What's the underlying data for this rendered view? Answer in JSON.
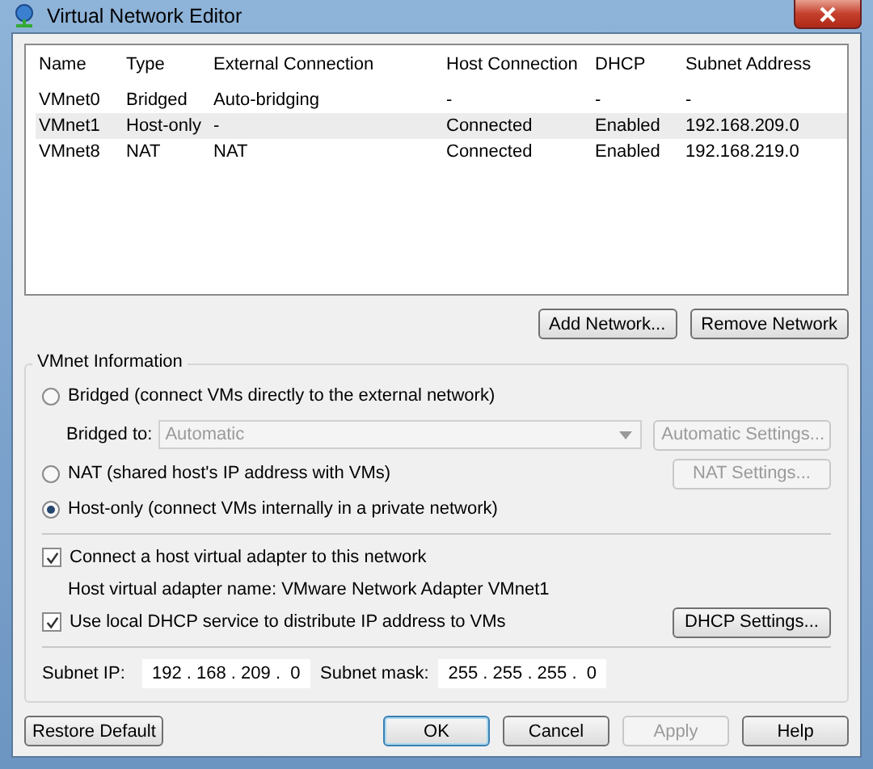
{
  "window": {
    "title": "Virtual Network Editor"
  },
  "table": {
    "columns": [
      "Name",
      "Type",
      "External Connection",
      "Host Connection",
      "DHCP",
      "Subnet Address"
    ],
    "rows": [
      {
        "cells": [
          "VMnet0",
          "Bridged",
          "Auto-bridging",
          "-",
          "-",
          "-"
        ],
        "selected": false
      },
      {
        "cells": [
          "VMnet1",
          "Host-only",
          "-",
          "Connected",
          "Enabled",
          "192.168.209.0"
        ],
        "selected": true
      },
      {
        "cells": [
          "VMnet8",
          "NAT",
          "NAT",
          "Connected",
          "Enabled",
          "192.168.219.0"
        ],
        "selected": false
      }
    ]
  },
  "network_buttons": [
    {
      "label": "Add Network..."
    },
    {
      "label": "Remove Network"
    }
  ],
  "vmnet_info": {
    "title": "VMnet Information",
    "modes": [
      {
        "label": "Bridged (connect VMs directly to the external network)",
        "selected": false
      },
      {
        "label": "NAT (shared host's IP address with VMs)",
        "selected": false
      },
      {
        "label": "Host-only (connect VMs internally in a private network)",
        "selected": true
      }
    ],
    "bridged_to": {
      "label": "Bridged to:",
      "value": "Automatic",
      "disabled": true
    },
    "automatic_settings": {
      "label": "Automatic Settings...",
      "disabled": true
    },
    "nat_settings": {
      "label": "NAT Settings...",
      "disabled": true
    },
    "connect_adapter": {
      "label": "Connect a host virtual adapter to this network",
      "checked": true
    },
    "adapter_name": "Host virtual adapter name: VMware Network Adapter VMnet1",
    "use_dhcp": {
      "label": "Use local DHCP service to distribute IP address to VMs",
      "checked": true
    },
    "dhcp_settings": {
      "label": "DHCP Settings...",
      "disabled": false
    },
    "subnet_ip": {
      "label": "Subnet IP:",
      "value": "192 . 168 . 209 .  0"
    },
    "subnet_mask": {
      "label": "Subnet mask:",
      "value": "255 . 255 . 255 .  0"
    }
  },
  "footer_buttons": [
    {
      "label": "Restore Default",
      "disabled": false,
      "default": false
    },
    {
      "label": "OK",
      "disabled": false,
      "default": true
    },
    {
      "label": "Cancel",
      "disabled": false,
      "default": false
    },
    {
      "label": "Apply",
      "disabled": true,
      "default": false
    },
    {
      "label": "Help",
      "disabled": false,
      "default": false
    }
  ]
}
